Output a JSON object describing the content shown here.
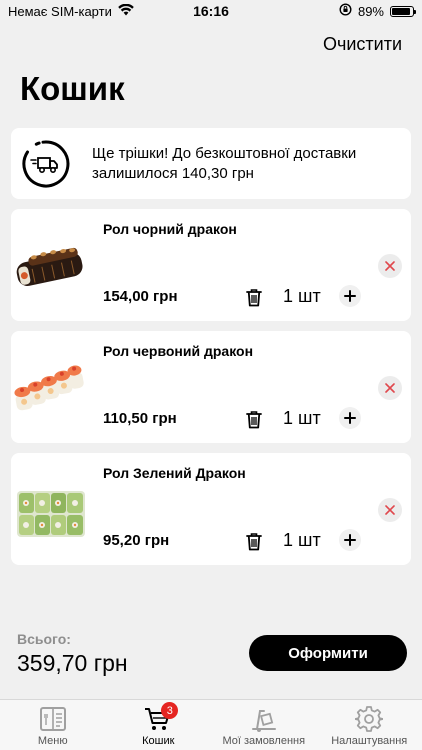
{
  "status": {
    "carrier": "Немає SIM-карти",
    "time": "16:16",
    "battery": "89%",
    "battery_level": 0.89
  },
  "header": {
    "clear_label": "Очистити",
    "title": "Кошик"
  },
  "delivery": {
    "message": "Ще трішки! До безкоштовної доставки залишилося 140,30 грн",
    "icon": "delivery-truck-icon"
  },
  "items": [
    {
      "name": "Рол чорний дракон",
      "price": "154,00 грн",
      "qty": "1 шт"
    },
    {
      "name": "Рол червоний дракон",
      "price": "110,50 грн",
      "qty": "1 шт"
    },
    {
      "name": "Рол Зелений Дракон",
      "price": "95,20 грн",
      "qty": "1 шт"
    }
  ],
  "summary": {
    "total_label": "Всього:",
    "total_value": "359,70 грн",
    "checkout_label": "Оформити"
  },
  "tabs": [
    {
      "label": "Меню",
      "icon": "menu-book-icon"
    },
    {
      "label": "Кошик",
      "icon": "cart-icon",
      "badge": "3"
    },
    {
      "label": "Мої замовлення",
      "icon": "orders-icon"
    },
    {
      "label": "Налаштування",
      "icon": "gear-icon"
    }
  ],
  "colors": {
    "accent": "#000000",
    "badge": "#e52521",
    "remove": "#e0484d",
    "background": "#f0f0f0"
  }
}
